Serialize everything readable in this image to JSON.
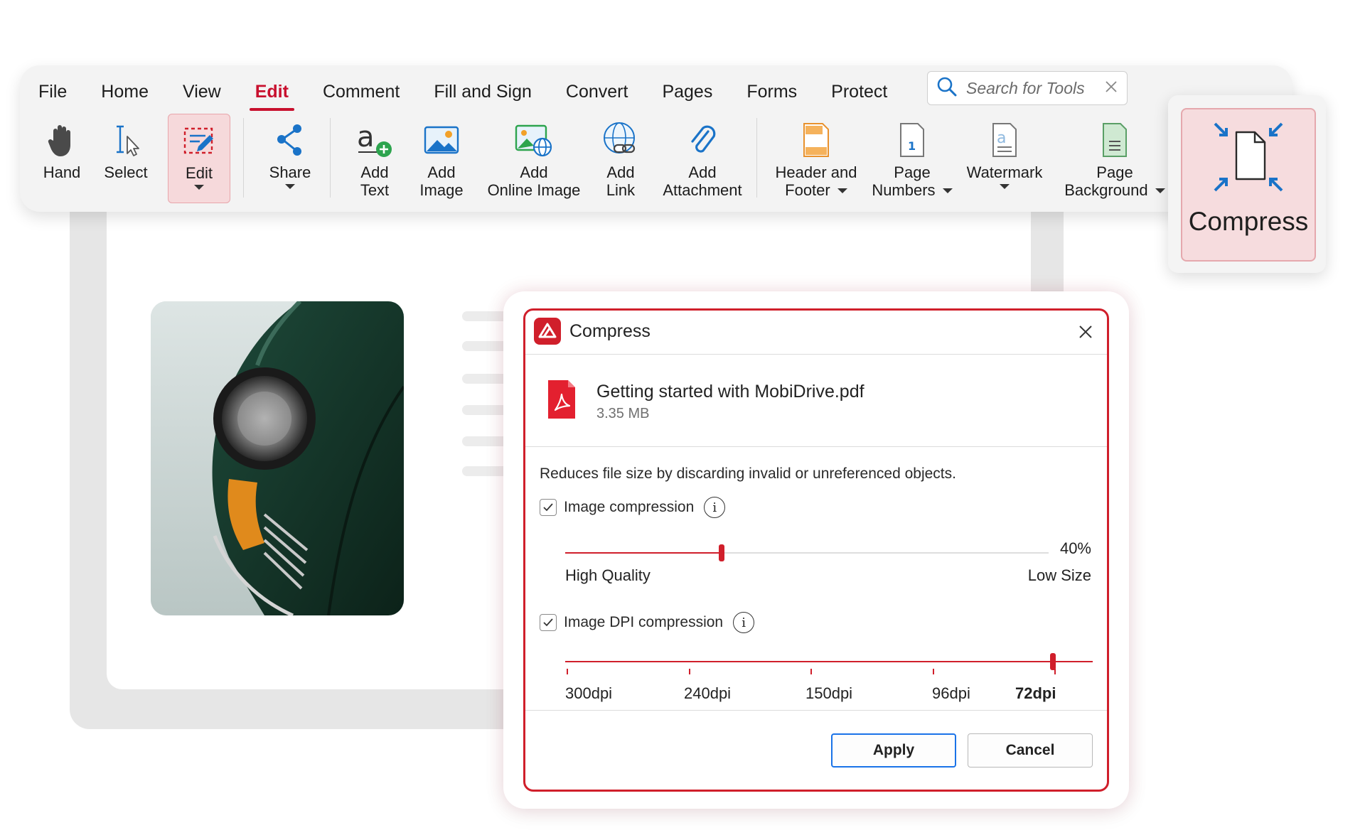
{
  "menu": {
    "items": [
      {
        "label": "File"
      },
      {
        "label": "Home"
      },
      {
        "label": "View"
      },
      {
        "label": "Edit",
        "active": true
      },
      {
        "label": "Comment"
      },
      {
        "label": "Fill and Sign"
      },
      {
        "label": "Convert"
      },
      {
        "label": "Pages"
      },
      {
        "label": "Forms"
      },
      {
        "label": "Protect"
      }
    ],
    "search_placeholder": "Search for Tools"
  },
  "toolbar": {
    "hand": {
      "line1": "Hand"
    },
    "select": {
      "line1": "Select"
    },
    "edit": {
      "line1": "Edit"
    },
    "share": {
      "line1": "Share"
    },
    "add_text": {
      "line1": "Add",
      "line2": "Text"
    },
    "add_image": {
      "line1": "Add",
      "line2": "Image"
    },
    "add_online_image": {
      "line1": "Add",
      "line2": "Online Image"
    },
    "add_link": {
      "line1": "Add",
      "line2": "Link"
    },
    "add_attachment": {
      "line1": "Add",
      "line2": "Attachment"
    },
    "header_footer": {
      "line1": "Header and",
      "line2": "Footer"
    },
    "page_numbers": {
      "line1": "Page",
      "line2": "Numbers"
    },
    "watermark": {
      "line1": "Watermark"
    },
    "page_background": {
      "line1": "Page",
      "line2": "Background"
    }
  },
  "compress_callout": {
    "label": "Compress"
  },
  "dialog": {
    "title": "Compress",
    "file": {
      "name": "Getting started with MobiDrive.pdf",
      "size": "3.35 MB"
    },
    "description": "Reduces file size by discarding invalid or unreferenced objects.",
    "image_compression": {
      "label": "Image compression",
      "checked": true,
      "value_fraction": 0.4,
      "value_text": "40%",
      "left_label": "High Quality",
      "right_label": "Low Size"
    },
    "dpi_compression": {
      "label": "Image DPI compression",
      "checked": true,
      "options": [
        "300dpi",
        "240dpi",
        "150dpi",
        "96dpi",
        "72dpi"
      ],
      "selected_index": 4
    },
    "buttons": {
      "apply": "Apply",
      "cancel": "Cancel"
    }
  },
  "colors": {
    "accent": "#d01f2b",
    "focus_blue": "#1a73e8",
    "icon_blue": "#1a73c8"
  }
}
